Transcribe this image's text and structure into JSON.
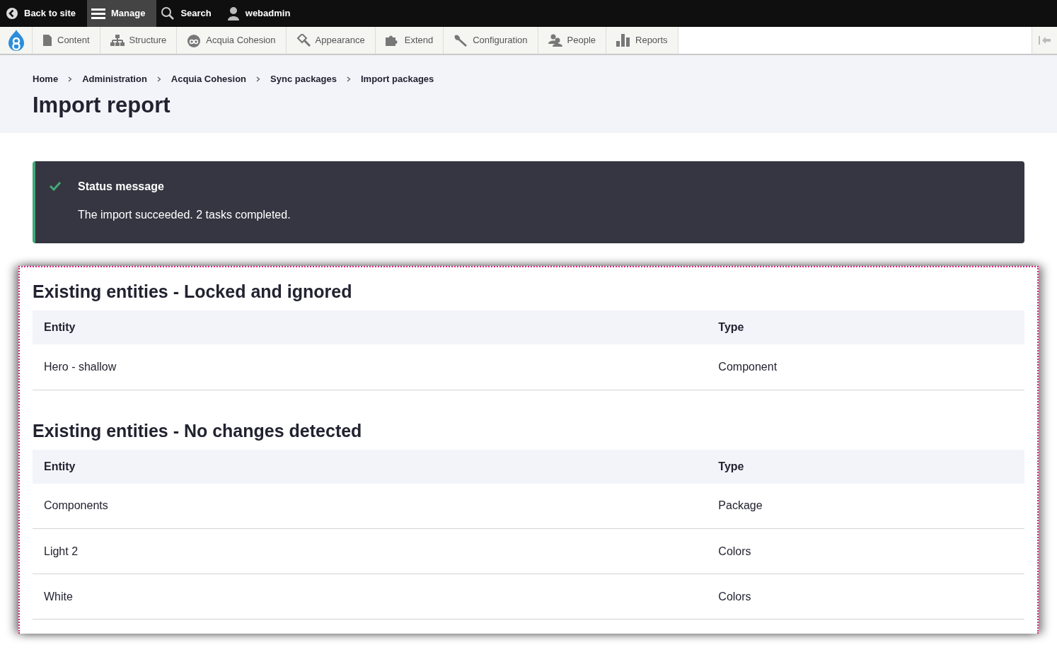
{
  "toolbar": {
    "items": [
      {
        "kind": "back",
        "label": "Back to site",
        "selected": false
      },
      {
        "kind": "menu",
        "label": "Manage",
        "selected": true
      },
      {
        "kind": "search",
        "label": "Search",
        "selected": false
      },
      {
        "kind": "user",
        "label": "webadmin",
        "selected": false
      }
    ]
  },
  "tray": {
    "items": [
      {
        "kind": "content",
        "label": "Content"
      },
      {
        "kind": "structure",
        "label": "Structure"
      },
      {
        "kind": "cohesion",
        "label": "Acquia Cohesion"
      },
      {
        "kind": "appearance",
        "label": "Appearance"
      },
      {
        "kind": "extend",
        "label": "Extend"
      },
      {
        "kind": "configuration",
        "label": "Configuration"
      },
      {
        "kind": "people",
        "label": "People"
      },
      {
        "kind": "reports",
        "label": "Reports"
      }
    ]
  },
  "breadcrumb": [
    "Home",
    "Administration",
    "Acquia Cohesion",
    "Sync packages",
    "Import packages"
  ],
  "page_title": "Import report",
  "status_message": {
    "title": "Status message",
    "text": "The import succeeded. 2 tasks completed."
  },
  "sections": [
    {
      "heading": "Existing entities - Locked and ignored",
      "columns": [
        "Entity",
        "Type"
      ],
      "rows": [
        [
          "Hero - shallow",
          "Component"
        ]
      ]
    },
    {
      "heading": "Existing entities - No changes detected",
      "columns": [
        "Entity",
        "Type"
      ],
      "rows": [
        [
          "Components",
          "Package"
        ],
        [
          "Light 2",
          "Colors"
        ],
        [
          "White",
          "Colors"
        ]
      ]
    }
  ]
}
